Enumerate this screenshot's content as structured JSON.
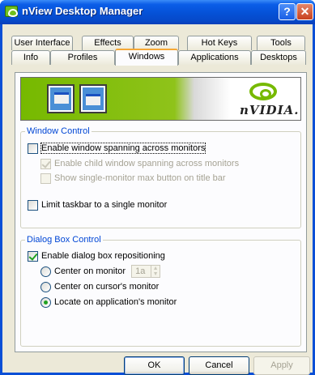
{
  "window": {
    "title": "nView Desktop Manager",
    "help_label": "?",
    "close_label": "✕"
  },
  "tabs": {
    "row_back": [
      "User Interface",
      "Effects",
      "Zoom",
      "Hot Keys",
      "Tools"
    ],
    "row_front": [
      "Info",
      "Profiles",
      "Windows",
      "Applications",
      "Desktops"
    ],
    "active": "Windows"
  },
  "banner": {
    "brand_text": "nVIDIA."
  },
  "window_control": {
    "label": "Window Control",
    "enable_spanning": {
      "label": "Enable window spanning across monitors",
      "checked": false
    },
    "enable_child_spanning": {
      "label": "Enable child window spanning across monitors",
      "checked": true,
      "disabled": true
    },
    "show_max_button": {
      "label": "Show single-monitor max button on title bar",
      "checked": false,
      "disabled": true
    },
    "limit_taskbar": {
      "label": "Limit taskbar to a single monitor",
      "checked": false
    }
  },
  "dialog_box_control": {
    "label": "Dialog Box Control",
    "enable_repositioning": {
      "label": "Enable dialog box repositioning",
      "checked": true
    },
    "center_on_monitor": {
      "label": "Center on monitor",
      "selected": false,
      "spinner_value": "1a"
    },
    "center_on_cursor": {
      "label": "Center on cursor's monitor",
      "selected": false
    },
    "locate_on_app": {
      "label": "Locate on application's monitor",
      "selected": true
    }
  },
  "buttons": {
    "ok": "OK",
    "cancel": "Cancel",
    "apply": "Apply"
  },
  "colors": {
    "titlebar": "#0551d6",
    "accent_group_label": "#0046d5",
    "nvidia_green": "#76b900"
  }
}
